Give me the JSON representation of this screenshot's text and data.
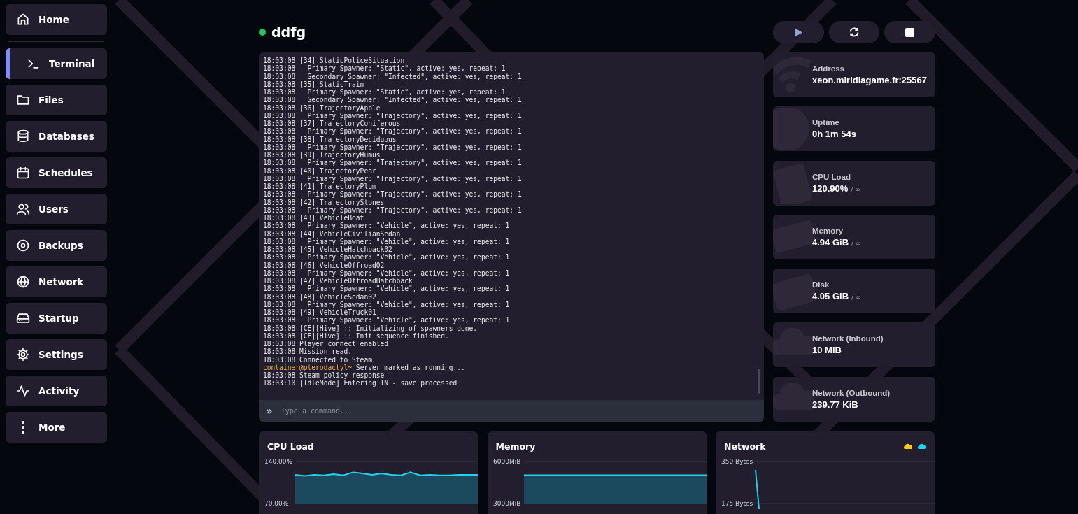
{
  "sidebar": {
    "items": [
      {
        "label": "Home",
        "selected": false
      },
      {
        "label": "Terminal",
        "selected": true
      },
      {
        "label": "Files",
        "selected": false
      },
      {
        "label": "Databases",
        "selected": false
      },
      {
        "label": "Schedules",
        "selected": false
      },
      {
        "label": "Users",
        "selected": false
      },
      {
        "label": "Backups",
        "selected": false
      },
      {
        "label": "Network",
        "selected": false
      },
      {
        "label": "Startup",
        "selected": false
      },
      {
        "label": "Settings",
        "selected": false
      },
      {
        "label": "Activity",
        "selected": false
      },
      {
        "label": "More",
        "selected": false
      }
    ]
  },
  "server": {
    "name": "ddfg",
    "online": true
  },
  "power_buttons": [
    {
      "kind": "start",
      "disabled": true
    },
    {
      "kind": "restart",
      "disabled": false
    },
    {
      "kind": "stop",
      "disabled": false
    }
  ],
  "terminal": {
    "lines": [
      {
        "kind": "log",
        "text": "18:03:08 [34] StaticPoliceSituation"
      },
      {
        "kind": "log",
        "text": "18:03:08   Primary Spawner: \"Static\", active: yes, repeat: 1"
      },
      {
        "kind": "log",
        "text": "18:03:08   Secondary Spawner: \"Infected\", active: yes, repeat: 1"
      },
      {
        "kind": "log",
        "text": "18:03:08 [35] StaticTrain"
      },
      {
        "kind": "log",
        "text": "18:03:08   Primary Spawner: \"Static\", active: yes, repeat: 1"
      },
      {
        "kind": "log",
        "text": "18:03:08   Secondary Spawner: \"Infected\", active: yes, repeat: 1"
      },
      {
        "kind": "log",
        "text": "18:03:08 [36] TrajectoryApple"
      },
      {
        "kind": "log",
        "text": "18:03:08   Primary Spawner: \"Trajectory\", active: yes, repeat: 1"
      },
      {
        "kind": "log",
        "text": "18:03:08 [37] TrajectoryConiferous"
      },
      {
        "kind": "log",
        "text": "18:03:08   Primary Spawner: \"Trajectory\", active: yes, repeat: 1"
      },
      {
        "kind": "log",
        "text": "18:03:08 [38] TrajectoryDeciduous"
      },
      {
        "kind": "log",
        "text": "18:03:08   Primary Spawner: \"Trajectory\", active: yes, repeat: 1"
      },
      {
        "kind": "log",
        "text": "18:03:08 [39] TrajectoryHumus"
      },
      {
        "kind": "log",
        "text": "18:03:08   Primary Spawner: \"Trajectory\", active: yes, repeat: 1"
      },
      {
        "kind": "log",
        "text": "18:03:08 [40] TrajectoryPear"
      },
      {
        "kind": "log",
        "text": "18:03:08   Primary Spawner: \"Trajectory\", active: yes, repeat: 1"
      },
      {
        "kind": "log",
        "text": "18:03:08 [41] TrajectoryPlum"
      },
      {
        "kind": "log",
        "text": "18:03:08   Primary Spawner: \"Trajectory\", active: yes, repeat: 1"
      },
      {
        "kind": "log",
        "text": "18:03:08 [42] TrajectoryStones"
      },
      {
        "kind": "log",
        "text": "18:03:08   Primary Spawner: \"Trajectory\", active: yes, repeat: 1"
      },
      {
        "kind": "log",
        "text": "18:03:08 [43] VehicleBoat"
      },
      {
        "kind": "log",
        "text": "18:03:08   Primary Spawner: \"Vehicle\", active: yes, repeat: 1"
      },
      {
        "kind": "log",
        "text": "18:03:08 [44] VehicleCivilianSedan"
      },
      {
        "kind": "log",
        "text": "18:03:08   Primary Spawner: \"Vehicle\", active: yes, repeat: 1"
      },
      {
        "kind": "log",
        "text": "18:03:08 [45] VehicleHatchback02"
      },
      {
        "kind": "log",
        "text": "18:03:08   Primary Spawner: \"Vehicle\", active: yes, repeat: 1"
      },
      {
        "kind": "log",
        "text": "18:03:08 [46] VehicleOffroad02"
      },
      {
        "kind": "log",
        "text": "18:03:08   Primary Spawner: \"Vehicle\", active: yes, repeat: 1"
      },
      {
        "kind": "log",
        "text": "18:03:08 [47] VehicleOffroadHatchback"
      },
      {
        "kind": "log",
        "text": "18:03:08   Primary Spawner: \"Vehicle\", active: yes, repeat: 1"
      },
      {
        "kind": "log",
        "text": "18:03:08 [48] VehicleSedan02"
      },
      {
        "kind": "log",
        "text": "18:03:08   Primary Spawner: \"Vehicle\", active: yes, repeat: 1"
      },
      {
        "kind": "log",
        "text": "18:03:08 [49] VehicleTruck01"
      },
      {
        "kind": "log",
        "text": "18:03:08   Primary Spawner: \"Vehicle\", active: yes, repeat: 1"
      },
      {
        "kind": "log",
        "text": "18:03:08 [CE][Hive] :: Initializing of spawners done."
      },
      {
        "kind": "log",
        "text": "18:03:08 [CE][Hive] :: Init sequence finished."
      },
      {
        "kind": "log",
        "text": "18:03:08 Player connect enabled"
      },
      {
        "kind": "log",
        "text": "18:03:08 Mission read."
      },
      {
        "kind": "log",
        "text": "18:03:08 Connected to Steam"
      },
      {
        "kind": "prompt",
        "prefix": "container@pterodactyl~",
        "text": "Server marked as running..."
      },
      {
        "kind": "log",
        "text": "18:03:08 Steam policy response"
      },
      {
        "kind": "log",
        "text": "18:03:10 [IdleMode] Entering IN - save processed"
      }
    ],
    "command": {
      "prompt": "»",
      "placeholder": "Type a command..."
    }
  },
  "stats": [
    {
      "label": "Address",
      "value": "xeon.miridiagame.fr:25567"
    },
    {
      "label": "Uptime",
      "value": "0h 1m 54s"
    },
    {
      "label": "CPU Load",
      "value": "120.90%",
      "limit": "/ ∞"
    },
    {
      "label": "Memory",
      "value": "4.94 GiB",
      "limit": "/ ∞"
    },
    {
      "label": "Disk",
      "value": "4.05 GiB",
      "limit": "/ ∞"
    },
    {
      "label": "Network (Inbound)",
      "value": "10 MiB"
    },
    {
      "label": "Network (Outbound)",
      "value": "239.77 KiB"
    }
  ],
  "charts": [
    {
      "title": "CPU Load",
      "chart_data": {
        "type": "area",
        "series": [
          {
            "color": "#22d3ee",
            "values": [
              118,
              116,
              118,
              117,
              119,
              117,
              122,
              120,
              118,
              120,
              118,
              117,
              122,
              117,
              118,
              117,
              117,
              118,
              118,
              118
            ]
          }
        ],
        "ylim": [
          70,
          140
        ],
        "yticks": [
          {
            "value": 140,
            "label": "140.00%"
          },
          {
            "value": 70,
            "label": "70.00%"
          }
        ]
      }
    },
    {
      "title": "Memory",
      "chart_data": {
        "type": "area",
        "series": [
          {
            "color": "#22d3ee",
            "values": [
              5030,
              5030,
              5030,
              5030,
              5030,
              5030,
              5030,
              5030,
              5030,
              5030,
              5030,
              5030,
              5030,
              5030,
              5030,
              5030,
              5030,
              5030,
              5030,
              5030
            ]
          }
        ],
        "ylim": [
          3000,
          6000
        ],
        "yticks": [
          {
            "value": 6000,
            "label": "6000MiB"
          },
          {
            "value": 3000,
            "label": "3000MiB"
          }
        ]
      }
    },
    {
      "title": "Network",
      "legend": [
        {
          "color": "#facc15"
        },
        {
          "color": "#22d3ee"
        }
      ],
      "axis_labels": [
        "350 Bytes",
        "175 Bytes"
      ]
    }
  ]
}
